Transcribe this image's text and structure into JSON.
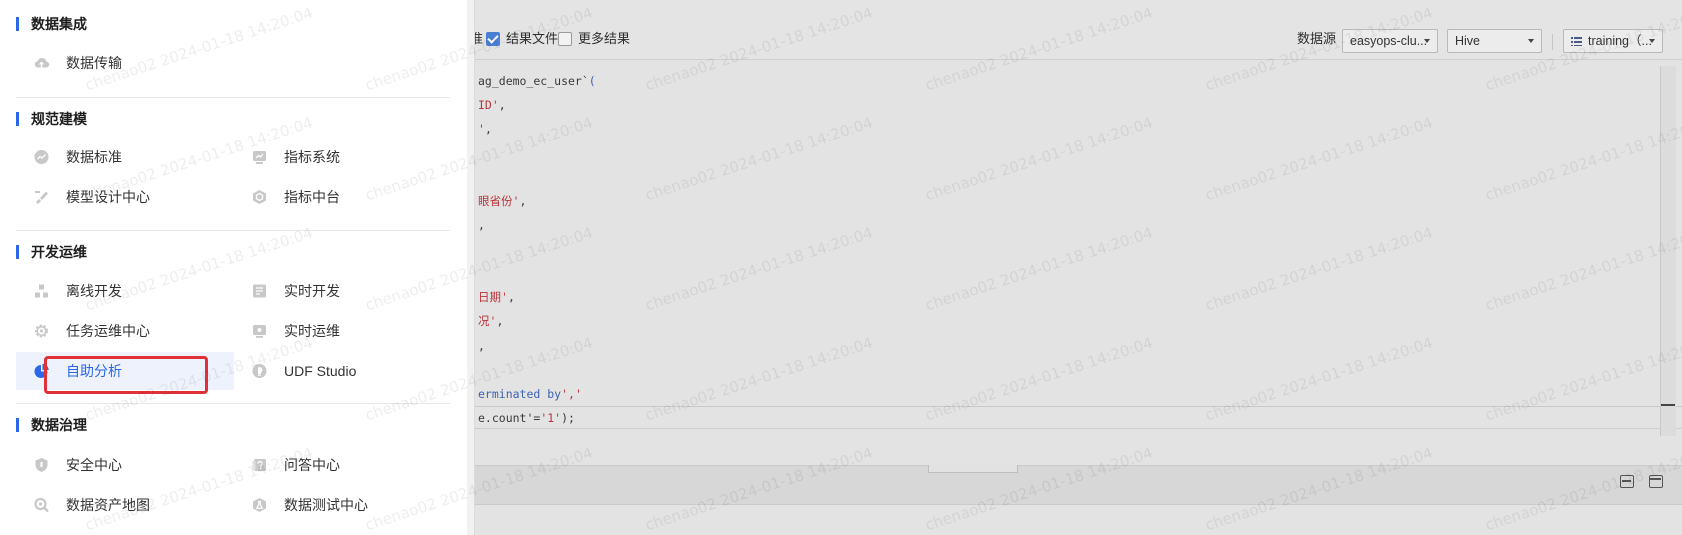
{
  "toolbar": {
    "partial_text": "准",
    "result_file_label": "结果文件",
    "result_file_checked": true,
    "more_results_label": "更多结果",
    "more_results_checked": false,
    "datasource_label": "数据源",
    "datasource_value": "easyops-clu...",
    "engine_value": "Hive",
    "database_value": "training（..."
  },
  "code_lines": [
    {
      "segments": [
        {
          "t": "ag_demo_ec_user`",
          "c": "plain"
        },
        {
          "t": "(",
          "c": "kw"
        }
      ]
    },
    {
      "segments": [
        {
          "t": "ID'",
          "c": "str"
        },
        {
          "t": ",",
          "c": "plain"
        }
      ]
    },
    {
      "segments": [
        {
          "t": "'",
          "c": "str"
        },
        {
          "t": ",",
          "c": "plain"
        }
      ]
    },
    {
      "segments": [
        {
          "t": "眼省份'",
          "c": "str"
        },
        {
          "t": ",",
          "c": "plain"
        }
      ]
    },
    {
      "segments": [
        {
          "t": ",",
          "c": "plain"
        }
      ]
    },
    {
      "segments": [
        {
          "t": "日期'",
          "c": "str"
        },
        {
          "t": ",",
          "c": "plain"
        }
      ]
    },
    {
      "segments": [
        {
          "t": "况'",
          "c": "str"
        },
        {
          "t": ",",
          "c": "plain"
        }
      ]
    },
    {
      "segments": [
        {
          "t": ",",
          "c": "plain"
        }
      ]
    },
    {
      "segments": [
        {
          "t": "erminated by",
          "c": "kw"
        },
        {
          "t": "','",
          "c": "str"
        }
      ]
    },
    {
      "segments": [
        {
          "t": "e.count'",
          "c": "plain"
        },
        {
          "t": "=",
          "c": "plain"
        },
        {
          "t": "'1'",
          "c": "str"
        },
        {
          "t": ");",
          "c": "plain"
        }
      ]
    }
  ],
  "menu": {
    "sections": [
      {
        "title": "数据集成",
        "items": [
          {
            "label": "数据传输",
            "icon": "cloud-upload-icon"
          }
        ]
      },
      {
        "title": "规范建模",
        "items": [
          {
            "label": "数据标准",
            "icon": "trend-circle-icon"
          },
          {
            "label": "指标系统",
            "icon": "chart-board-icon"
          },
          {
            "label": "模型设计中心",
            "icon": "brush-icon"
          },
          {
            "label": "指标中台",
            "icon": "hexagon-icon"
          }
        ]
      },
      {
        "title": "开发运维",
        "items": [
          {
            "label": "离线开发",
            "icon": "hierarchy-icon"
          },
          {
            "label": "实时开发",
            "icon": "list-board-icon"
          },
          {
            "label": "任务运维中心",
            "icon": "gear-icon"
          },
          {
            "label": "实时运维",
            "icon": "monitor-icon"
          },
          {
            "label": "自助分析",
            "icon": "pie-chart-icon",
            "active": true
          },
          {
            "label": "UDF Studio",
            "icon": "bulb-icon"
          }
        ]
      },
      {
        "title": "数据治理",
        "items": [
          {
            "label": "安全中心",
            "icon": "shield-icon"
          },
          {
            "label": "问答中心",
            "icon": "qa-board-icon"
          },
          {
            "label": "数据资产地图",
            "icon": "search-icon"
          },
          {
            "label": "数据测试中心",
            "icon": "flask-icon"
          }
        ]
      }
    ]
  },
  "watermark": "chenao02 2024-01-18 14:20:04",
  "colors": {
    "accent": "#2b67e8",
    "highlight": "#e0303a",
    "active_bg": "#edf2fd"
  }
}
